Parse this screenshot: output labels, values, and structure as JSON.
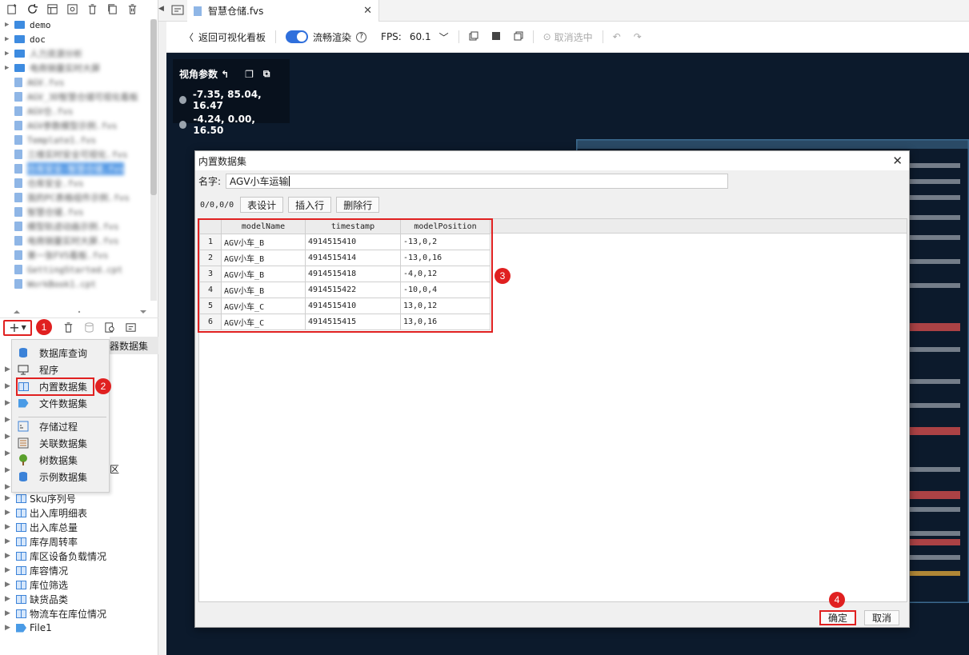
{
  "file_tree": [
    {
      "label": "demo",
      "type": "folder"
    },
    {
      "label": "doc",
      "type": "folder"
    },
    {
      "label": "人力资源分析",
      "type": "folder",
      "blurred": true
    },
    {
      "label": "电商销量实时大屏",
      "type": "folder",
      "blurred": true
    },
    {
      "label": "AGV.fvs",
      "type": "fvs",
      "blurred": true
    },
    {
      "label": "AGV_3D智慧仓储可视化看板",
      "type": "fvs",
      "blurred": true
    },
    {
      "label": "AGV仓.fvs",
      "type": "fvs",
      "blurred": true
    },
    {
      "label": "AGV参数模型示例.fvs",
      "type": "fvs",
      "blurred": true
    },
    {
      "label": "Template1.fvs",
      "type": "fvs",
      "blurred": true
    },
    {
      "label": "三维实时安全可视化.fvs",
      "type": "fvs",
      "blurred": true
    },
    {
      "label": "仓库安全-智慧仓储.fvs",
      "type": "fvs",
      "blurred": true,
      "selected": true
    },
    {
      "label": "仓库安全.fvs",
      "type": "fvs",
      "blurred": true
    },
    {
      "label": "我的PC表格组件示例.fvs",
      "type": "fvs",
      "blurred": true
    },
    {
      "label": "智慧仓储.fvs",
      "type": "fvs",
      "blurred": true
    },
    {
      "label": "模型轨迹动画示例.fvs",
      "type": "fvs",
      "blurred": true
    },
    {
      "label": "电商销量实时大屏.fvs",
      "type": "fvs",
      "blurred": true
    },
    {
      "label": "第一张FVS看板.fvs",
      "type": "fvs",
      "blurred": true
    },
    {
      "label": "GettingStarted.cpt",
      "type": "fvs",
      "blurred": true
    },
    {
      "label": "WorkBook1.cpt",
      "type": "fvs",
      "blurred": true
    }
  ],
  "ds_tree_hidden_header": "器数据集",
  "ds_tree": [
    {
      "label": "Sku序列号"
    },
    {
      "label": "出入库明细表"
    },
    {
      "label": "出入库总量"
    },
    {
      "label": "库存周转率"
    },
    {
      "label": "库区设备负载情况"
    },
    {
      "label": "库容情况"
    },
    {
      "label": "库位筛选"
    },
    {
      "label": "缺货品类"
    },
    {
      "label": "物流车在库位情况"
    },
    {
      "label": "File1",
      "file": true
    }
  ],
  "ds_tree_partial": "区",
  "add_menu": {
    "items": [
      "数据库查询",
      "程序",
      "内置数据集",
      "文件数据集",
      "存储过程",
      "关联数据集",
      "树数据集",
      "示例数据集"
    ]
  },
  "callouts": [
    "1",
    "2",
    "3",
    "4"
  ],
  "tab": {
    "title": "智慧仓储.fvs"
  },
  "toolbar": {
    "back_label": "返回可视化看板",
    "smooth_label": "流畅渲染",
    "fps_label": "FPS:",
    "fps_value": "60.1",
    "deselect_label": "取消选中"
  },
  "camera": {
    "title": "视角参数",
    "position": "-7.35, 85.04, 16.47",
    "target": "-4.24, 0.00, 16.50"
  },
  "dialog": {
    "title": "内置数据集",
    "name_label": "名字:",
    "name_value": "AGV小车运输",
    "count_label": "0/0,0/0",
    "btn_design": "表设计",
    "btn_insert": "插入行",
    "btn_delete": "删除行",
    "columns": [
      "modelName",
      "timestamp",
      "modelPosition"
    ],
    "rows": [
      [
        "1",
        "AGV小车_B",
        "4914515410",
        "-13,0,2"
      ],
      [
        "2",
        "AGV小车_B",
        "4914515414",
        "-13,0,16"
      ],
      [
        "3",
        "AGV小车_B",
        "4914515418",
        "-4,0,12"
      ],
      [
        "4",
        "AGV小车_B",
        "4914515422",
        "-10,0,4"
      ],
      [
        "5",
        "AGV小车_C",
        "4914515410",
        "13,0,12"
      ],
      [
        "6",
        "AGV小车_C",
        "4914515415",
        "13,0,16"
      ]
    ],
    "ok_label": "确定",
    "cancel_label": "取消"
  },
  "colors": {
    "accent": "#2f6fdc",
    "callout": "#e02020",
    "canvas_bg": "#0c1a2c"
  }
}
